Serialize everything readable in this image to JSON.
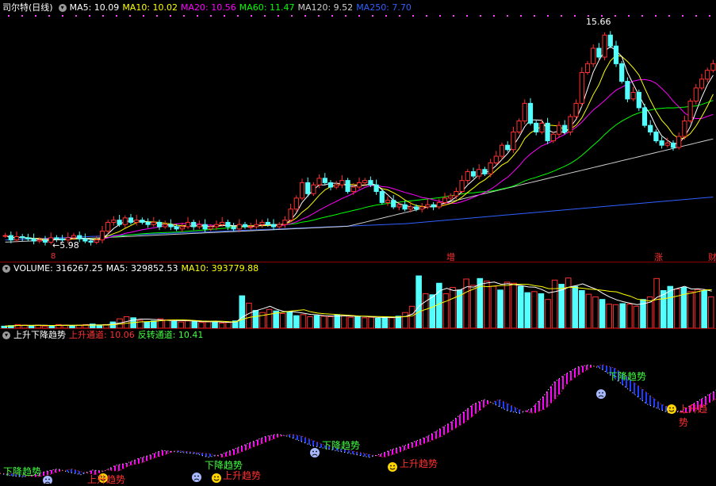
{
  "price_panel": {
    "title": "司尔特(日线)",
    "ma_labels": [
      {
        "text": "MA5: 10.09",
        "color": "#ffffff"
      },
      {
        "text": "MA10: 10.02",
        "color": "#ffff00"
      },
      {
        "text": "MA20: 10.56",
        "color": "#ff00ff"
      },
      {
        "text": "MA60: 11.47",
        "color": "#00ff00"
      },
      {
        "text": "MA120: 9.52",
        "color": "#cfcfcf"
      },
      {
        "text": "MA250: 7.70",
        "color": "#3060ff"
      }
    ],
    "high_label": "15.66",
    "low_label": "5.98",
    "bottom_markers": [
      "8",
      "增",
      "涨",
      "财"
    ]
  },
  "volume_panel": {
    "labels": [
      {
        "text": "VOLUME: 316267.25",
        "color": "#ffffff"
      },
      {
        "text": "MA5: 329852.53",
        "color": "#ffffff"
      },
      {
        "text": "MA10: 393779.88",
        "color": "#ffff00"
      }
    ]
  },
  "trend_panel": {
    "labels": [
      {
        "text": "上升下降趋势",
        "color": "#ffffff"
      },
      {
        "text": "上升通道: 10.06",
        "color": "#ff3030"
      },
      {
        "text": "反转通道: 10.41",
        "color": "#40ff40"
      }
    ],
    "signal_down": "下降趋势",
    "signal_up": "上升趋势"
  },
  "colors": {
    "up": "#ff3030",
    "down": "#54ffff",
    "ma5": "#ffffff",
    "ma10": "#ffff00",
    "ma20": "#ff00ff",
    "ma60": "#00ff00",
    "ma120": "#cfcfcf",
    "ma250": "#3060ff",
    "trend_up_fill": "#ff00ff",
    "trend_down_fill": "#1e3cff"
  },
  "chart_data": {
    "type": "line",
    "price_range": [
      5.98,
      15.66
    ],
    "price_levels": [
      6.3,
      6.1,
      6.25,
      6.2,
      6.15,
      6.05,
      6.1,
      6.0,
      6.2,
      6.15,
      6.1,
      6.2,
      6.3,
      6.15,
      6.05,
      6.0,
      6.1,
      6.5,
      6.9,
      7.0,
      6.8,
      7.1,
      6.9,
      7.0,
      6.9,
      6.8,
      6.9,
      6.7,
      6.8,
      6.7,
      6.6,
      6.7,
      6.9,
      6.7,
      6.8,
      6.6,
      6.7,
      6.8,
      6.9,
      6.7,
      6.6,
      6.8,
      6.7,
      6.7,
      6.8,
      6.9,
      6.8,
      6.7,
      6.8,
      7.0,
      7.5,
      8.0,
      8.7,
      8.2,
      8.6,
      8.9,
      8.7,
      8.5,
      8.6,
      8.8,
      8.3,
      8.5,
      8.7,
      8.8,
      8.6,
      8.3,
      7.8,
      7.9,
      7.6,
      7.7,
      7.5,
      7.6,
      7.5,
      7.6,
      7.7,
      7.6,
      7.8,
      8.0,
      8.1,
      8.3,
      8.8,
      9.2,
      9.0,
      9.3,
      9.1,
      9.6,
      9.9,
      10.4,
      10.2,
      11.0,
      11.5,
      12.3,
      11.4,
      11.0,
      11.4,
      10.6,
      10.9,
      11.3,
      11.0,
      11.7,
      12.3,
      13.7,
      14.1,
      14.8,
      14.4,
      15.4,
      14.9,
      14.1,
      13.3,
      12.5,
      12.8,
      12.1,
      11.3,
      11.0,
      10.6,
      10.4,
      10.5,
      10.3,
      10.8,
      11.5,
      12.4,
      13.0,
      13.4,
      13.8,
      14.1
    ],
    "volume_levels": [
      0.04,
      0.05,
      0.07,
      0.06,
      0.05,
      0.06,
      0.04,
      0.05,
      0.07,
      0.06,
      0.05,
      0.06,
      0.07,
      0.08,
      0.06,
      0.07,
      0.12,
      0.18,
      0.22,
      0.2,
      0.15,
      0.12,
      0.14,
      0.18,
      0.16,
      0.13,
      0.12,
      0.14,
      0.13,
      0.11,
      0.12,
      0.13,
      0.1,
      0.11,
      0.14,
      0.62,
      0.48,
      0.34,
      0.3,
      0.36,
      0.33,
      0.28,
      0.32,
      0.24,
      0.26,
      0.22,
      0.24,
      0.23,
      0.22,
      0.26,
      0.24,
      0.21,
      0.22,
      0.2,
      0.21,
      0.19,
      0.22,
      0.2,
      0.23,
      0.3,
      0.42,
      1.0,
      0.66,
      0.64,
      0.86,
      0.66,
      0.78,
      0.73,
      0.94,
      0.82,
      0.95,
      0.9,
      0.8,
      0.73,
      0.88,
      0.86,
      0.8,
      0.68,
      0.7,
      0.66,
      0.55,
      0.92,
      0.84,
      0.96,
      0.8,
      0.72,
      0.65,
      0.6,
      0.55,
      0.46,
      0.45,
      0.47,
      0.46,
      0.42,
      0.55,
      0.6,
      0.95,
      0.72,
      0.8,
      0.75,
      0.78,
      0.7,
      0.74,
      0.72,
      0.6
    ],
    "trend_levels": [
      0.06,
      0.04,
      0.03,
      0.05,
      0.08,
      0.1,
      0.07,
      0.05,
      0.09,
      0.08,
      0.13,
      0.15,
      0.19,
      0.22,
      0.26,
      0.25,
      0.24,
      0.23,
      0.2,
      0.22,
      0.26,
      0.3,
      0.34,
      0.38,
      0.4,
      0.38,
      0.34,
      0.3,
      0.28,
      0.26,
      0.24,
      0.22,
      0.2,
      0.23,
      0.27,
      0.3,
      0.34,
      0.38,
      0.44,
      0.5,
      0.58,
      0.66,
      0.7,
      0.65,
      0.6,
      0.58,
      0.62,
      0.72,
      0.85,
      0.92,
      0.98,
      1.0,
      0.97,
      0.9,
      0.82,
      0.74,
      0.66,
      0.62,
      0.58,
      0.6,
      0.66,
      0.72,
      0.78
    ]
  }
}
